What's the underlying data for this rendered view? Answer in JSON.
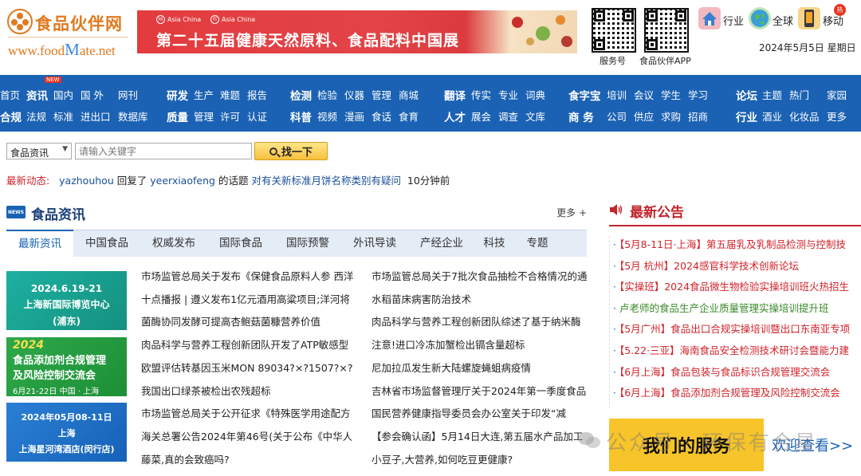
{
  "header": {
    "logo_cn": "食品伙伴网",
    "logo_en_pre": "www.food",
    "logo_en_m": "M",
    "logo_en_post": "ate.net",
    "banner_tag1": "Asia China",
    "banner_tag2": "Asia China",
    "banner_title": "第二十五届健康天然原料、食品配料中国展",
    "qr1_label": "服务号",
    "qr2_label": "食品伙伴APP",
    "links": [
      "行业",
      "全球",
      "移动"
    ],
    "hot_badge": "热",
    "date": "2024年5月5日 星期日"
  },
  "nav": {
    "new_badge": "NEW",
    "row1": [
      {
        "t": "首页",
        "b": false
      },
      {
        "t": "资讯",
        "b": true
      },
      {
        "t": "国内",
        "b": false
      },
      {
        "t": "国 外",
        "b": false
      },
      {
        "t": "网刊",
        "b": false
      },
      {
        "t": "研发",
        "b": true
      },
      {
        "t": "生产",
        "b": false
      },
      {
        "t": "难题",
        "b": false
      },
      {
        "t": "报告",
        "b": false
      },
      {
        "t": "检测",
        "b": true
      },
      {
        "t": "检验",
        "b": false
      },
      {
        "t": "仪器",
        "b": false
      },
      {
        "t": "管理",
        "b": false
      },
      {
        "t": "商城",
        "b": false
      },
      {
        "t": "翻译",
        "b": true
      },
      {
        "t": "传实",
        "b": false
      },
      {
        "t": "专业",
        "b": false
      },
      {
        "t": "词典",
        "b": false
      },
      {
        "t": "食字宝",
        "b": true
      },
      {
        "t": "培训",
        "b": false
      },
      {
        "t": "会议",
        "b": false
      },
      {
        "t": "学生",
        "b": false
      },
      {
        "t": "学习",
        "b": false
      },
      {
        "t": "论坛",
        "b": true
      },
      {
        "t": "主题",
        "b": false
      },
      {
        "t": "热门",
        "b": false
      },
      {
        "t": "家园",
        "b": false
      }
    ],
    "row2": [
      {
        "t": "合规",
        "b": true
      },
      {
        "t": "法规",
        "b": false
      },
      {
        "t": "标准",
        "b": false
      },
      {
        "t": "进出口",
        "b": false
      },
      {
        "t": "数据库",
        "b": false
      },
      {
        "t": "质量",
        "b": true
      },
      {
        "t": "管理",
        "b": false
      },
      {
        "t": "许可",
        "b": false
      },
      {
        "t": "认证",
        "b": false
      },
      {
        "t": "科普",
        "b": true
      },
      {
        "t": "视频",
        "b": false
      },
      {
        "t": "漫画",
        "b": false
      },
      {
        "t": "食话",
        "b": false
      },
      {
        "t": "食育",
        "b": false
      },
      {
        "t": "人才",
        "b": true
      },
      {
        "t": "展会",
        "b": false
      },
      {
        "t": "调查",
        "b": false
      },
      {
        "t": "文库",
        "b": false
      },
      {
        "t": "商 务",
        "b": true
      },
      {
        "t": "公司",
        "b": false
      },
      {
        "t": "供应",
        "b": false
      },
      {
        "t": "求购",
        "b": false
      },
      {
        "t": "招商",
        "b": false
      },
      {
        "t": "行业",
        "b": true
      },
      {
        "t": "酒业",
        "b": false
      },
      {
        "t": "化妆品",
        "b": false
      },
      {
        "t": "更多",
        "b": false
      }
    ]
  },
  "search": {
    "category": "食品资讯",
    "placeholder": "请输入关键字",
    "button": "找一下"
  },
  "latest": {
    "label": "最新动态:",
    "user": "yazhouhou",
    "action": "回复了",
    "target_user": "yeerxiaofeng",
    "mid": "的话题",
    "topic": "对有关新标准月饼名称类别有疑问",
    "time": "10分钟前"
  },
  "news": {
    "icon_text": "NEWS",
    "title": "食品资讯",
    "more": "更多 +",
    "tabs": [
      "最新资讯",
      "中国食品",
      "权威发布",
      "国际食品",
      "国际预警",
      "外讯导读",
      "产经企业",
      "科技",
      "专题"
    ],
    "promo1": {
      "line1": "2024.6.19-21",
      "line2": "上海新国际博览中心",
      "line3": "(浦东)"
    },
    "promo2": {
      "year": "2024",
      "line1": "食品添加剂合规管理",
      "line2": "及风险控制交流会",
      "line3": "6月21-22日 中国 · 上海"
    },
    "promo3": {
      "line1": "2024年05月08-11日",
      "line2": "上海",
      "line3": "上海星河湾酒店(闵行店)"
    },
    "col1": [
      "市场监管总局关于发布《保健食品原料人参 西洋",
      "十点播报 | 遵义发布1亿元酒用高粱项目;洋河将",
      "菌酶协同发酵可提高杏鲍菇菌糠营养价值",
      "肉品科学与营养工程创新团队开发了ATP敏感型",
      "欧盟评估转基因玉米MON 89034?×?1507?×?",
      "我国出口绿茶被检出农残超标",
      "市场监管总局关于公开征求《特殊医学用途配方",
      "海关总署公告2024年第46号(关于公布《中华人",
      "藤菜,真的会致癌吗?"
    ],
    "col2": [
      "市场监管总局关于7批次食品抽检不合格情况的通",
      "水稻苗床病害防治技术",
      "肉品科学与营养工程创新团队综述了基于纳米酶",
      "注意!进口冷冻加蟹检出镉含量超标",
      "尼加拉瓜发生新大陆螺旋蝇蛆病疫情",
      "吉林省市场监督管理厅关于2024年第一季度食品",
      "国民营养健康指导委员会办公室关于印发“减",
      "【参会确认函】5月14日大连,第五届水产品加工",
      "小豆子,大营养,如何吃豆更健康?"
    ]
  },
  "notice": {
    "title": "最新公告",
    "items": [
      {
        "t": "【5月8-11日·上海】第五届乳及乳制品检测与控制技",
        "c": "r"
      },
      {
        "t": "【5月 杭州】2024感官科学技术创新论坛",
        "c": "r"
      },
      {
        "t": "【实操班】2024食品微生物检验实操培训班火热招生",
        "c": "r"
      },
      {
        "t": "卢老师的食品生产企业质量管理实操培训提升班",
        "c": "g"
      },
      {
        "t": "【5月广州】食品出口合规实操培训暨出口东南亚专项",
        "c": "r"
      },
      {
        "t": "【5.22·三亚】海南食品安全检测技术研讨会暨能力建",
        "c": "r"
      },
      {
        "t": "【6月上海】食品包装与食品标识合规管理交流会",
        "c": "r"
      },
      {
        "t": "【6月上海】食品添加剂合规管理及风险控制交流会",
        "c": "r"
      }
    ],
    "service": "我们的服务",
    "welcome": "欢迎查看>>"
  },
  "watermark": "公众号 · 环保有合星"
}
